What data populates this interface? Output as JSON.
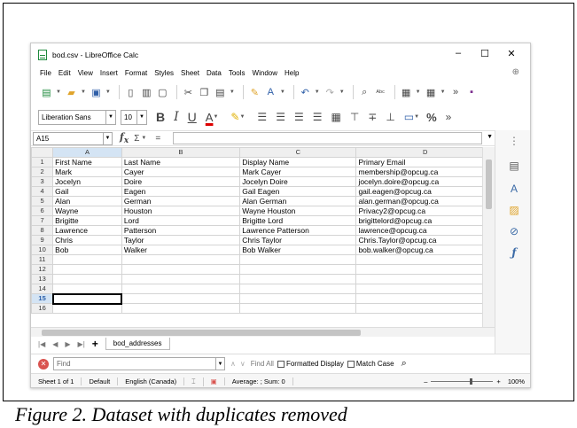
{
  "window": {
    "title": "bod.csv - LibreOffice Calc",
    "minimize": "–",
    "maximize": "☐",
    "close": "✕"
  },
  "menu": [
    "File",
    "Edit",
    "View",
    "Insert",
    "Format",
    "Styles",
    "Sheet",
    "Data",
    "Tools",
    "Window",
    "Help"
  ],
  "format_bar": {
    "font_name": "Liberation Sans",
    "font_size": "10",
    "bold": "B",
    "italic": "I",
    "underline": "U",
    "font_color": "A",
    "percent": "%"
  },
  "formula_bar": {
    "cell_ref": "A15",
    "fx": "f",
    "fx_sub": "x",
    "sigma": "Σ",
    "equals": "="
  },
  "sheet": {
    "columns": [
      "A",
      "B",
      "C",
      "D"
    ],
    "rows": [
      [
        "1",
        "First Name",
        "Last Name",
        "Display Name",
        "Primary Email"
      ],
      [
        "2",
        "Mark",
        "Cayer",
        "Mark Cayer",
        "membership@opcug.ca"
      ],
      [
        "3",
        "Jocelyn",
        "Doire",
        "Jocelyn Doire",
        "jocelyn.doire@opcug.ca"
      ],
      [
        "4",
        "Gail",
        "Eagen",
        "Gail Eagen",
        "gail.eagen@opcug.ca"
      ],
      [
        "5",
        "Alan",
        "German",
        "Alan German",
        "alan.german@opcug.ca"
      ],
      [
        "6",
        "Wayne",
        "Houston",
        "Wayne Houston",
        "Privacy2@opcug.ca"
      ],
      [
        "7",
        "Brigitte",
        "Lord",
        "Brigitte Lord",
        "brigittelord@opcug.ca"
      ],
      [
        "8",
        "Lawrence",
        "Patterson",
        "Lawrence Patterson",
        "lawrence@opcug.ca"
      ],
      [
        "9",
        "Chris",
        "Taylor",
        "Chris Taylor",
        "Chris.Taylor@opcug.ca"
      ],
      [
        "10",
        "Bob",
        "Walker",
        "Bob Walker",
        "bob.walker@opcug.ca"
      ],
      [
        "11",
        "",
        "",
        "",
        ""
      ],
      [
        "12",
        "",
        "",
        "",
        ""
      ],
      [
        "13",
        "",
        "",
        "",
        ""
      ],
      [
        "14",
        "",
        "",
        "",
        ""
      ],
      [
        "15",
        "",
        "",
        "",
        ""
      ],
      [
        "16",
        "",
        "",
        "",
        ""
      ]
    ],
    "active_row": "15",
    "active_col": "A",
    "tab": "bod_addresses",
    "add_tab": "+"
  },
  "find_bar": {
    "placeholder": "Find",
    "find_all": "Find All",
    "formatted_display": "Formatted Display",
    "match_case": "Match Case"
  },
  "status": {
    "sheet": "Sheet 1 of 1",
    "style": "Default",
    "language": "English (Canada)",
    "sum": "Average: ; Sum: 0",
    "zoom": "100%"
  },
  "caption": "Figure 2. Dataset with duplicates removed"
}
